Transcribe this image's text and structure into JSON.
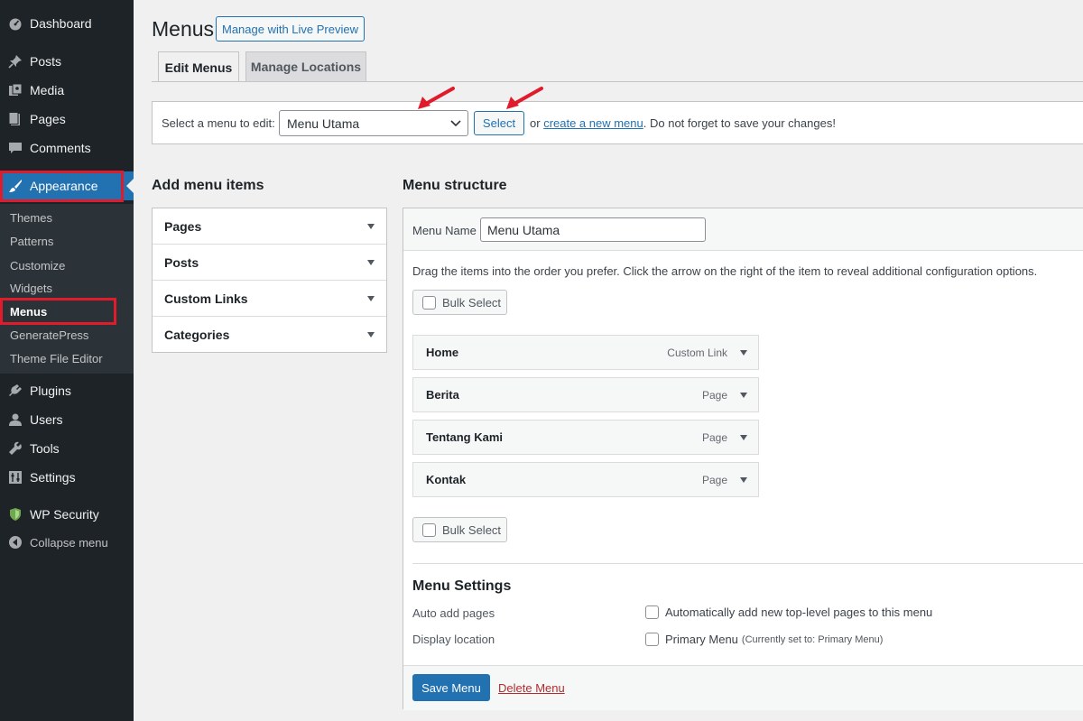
{
  "sidebar": {
    "items": [
      {
        "label": "Dashboard",
        "icon": "dashboard-icon"
      },
      {
        "label": "Posts",
        "icon": "pin-icon"
      },
      {
        "label": "Media",
        "icon": "media-icon"
      },
      {
        "label": "Pages",
        "icon": "pages-icon"
      },
      {
        "label": "Comments",
        "icon": "comment-icon"
      },
      {
        "label": "Appearance",
        "icon": "brush-icon"
      },
      {
        "label": "Plugins",
        "icon": "plugin-icon"
      },
      {
        "label": "Users",
        "icon": "user-icon"
      },
      {
        "label": "Tools",
        "icon": "wrench-icon"
      },
      {
        "label": "Settings",
        "icon": "settings-icon"
      },
      {
        "label": "WP Security",
        "icon": "shield-icon"
      },
      {
        "label": "Collapse menu",
        "icon": "collapse-icon"
      }
    ],
    "submenu": [
      "Themes",
      "Patterns",
      "Customize",
      "Widgets",
      "Menus",
      "GeneratePress",
      "Theme File Editor"
    ]
  },
  "header": {
    "title": "Menus",
    "live_preview": "Manage with Live Preview"
  },
  "tabs": [
    {
      "label": "Edit Menus"
    },
    {
      "label": "Manage Locations"
    }
  ],
  "select_bar": {
    "label": "Select a menu to edit:",
    "selected": "Menu Utama",
    "button": "Select",
    "or": "or",
    "create_link": "create a new menu",
    "note": ". Do not forget to save your changes!"
  },
  "add_items": {
    "title": "Add menu items",
    "sections": [
      "Pages",
      "Posts",
      "Custom Links",
      "Categories"
    ]
  },
  "structure": {
    "title": "Menu structure",
    "name_label": "Menu Name",
    "name_value": "Menu Utama",
    "instructions": "Drag the items into the order you prefer. Click the arrow on the right of the item to reveal additional configuration options.",
    "bulk_select": "Bulk Select",
    "items": [
      {
        "title": "Home",
        "type": "Custom Link"
      },
      {
        "title": "Berita",
        "type": "Page"
      },
      {
        "title": "Tentang Kami",
        "type": "Page"
      },
      {
        "title": "Kontak",
        "type": "Page"
      }
    ]
  },
  "settings": {
    "title": "Menu Settings",
    "auto_add_label": "Auto add pages",
    "auto_add_option": "Automatically add new top-level pages to this menu",
    "display_label": "Display location",
    "display_option": "Primary Menu",
    "display_note": "(Currently set to: Primary Menu)"
  },
  "actions": {
    "save": "Save Menu",
    "delete": "Delete Menu"
  },
  "colors": {
    "accent": "#2271b1",
    "highlight": "#e01b2c",
    "sidebar": "#1d2327"
  }
}
